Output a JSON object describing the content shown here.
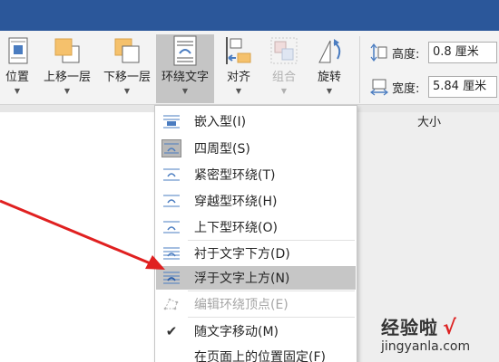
{
  "ribbon": {
    "buttons": [
      {
        "name": "position",
        "label": "位置",
        "icon": "position-icon",
        "state": "normal"
      },
      {
        "name": "bring-forward",
        "label": "上移一层",
        "icon": "bring-forward-icon",
        "state": "normal"
      },
      {
        "name": "send-backward",
        "label": "下移一层",
        "icon": "send-backward-icon",
        "state": "normal"
      },
      {
        "name": "wrap-text",
        "label": "环绕文字",
        "icon": "wrap-text-icon",
        "state": "selected"
      },
      {
        "name": "align",
        "label": "对齐",
        "icon": "align-icon",
        "state": "normal"
      },
      {
        "name": "group",
        "label": "组合",
        "icon": "group-icon",
        "state": "disabled"
      },
      {
        "name": "rotate",
        "label": "旋转",
        "icon": "rotate-icon",
        "state": "normal"
      }
    ],
    "size": {
      "height_label": "高度:",
      "height_value": "0.8 厘米",
      "width_label": "宽度:",
      "width_value": "5.84 厘米",
      "group_label": "大小"
    }
  },
  "menu": {
    "items": [
      {
        "label": "嵌入型(I)",
        "icon": "inline-icon",
        "state": "normal"
      },
      {
        "label": "四周型(S)",
        "icon": "square-wrap-icon",
        "state": "boxed"
      },
      {
        "label": "紧密型环绕(T)",
        "icon": "tight-wrap-icon",
        "state": "normal"
      },
      {
        "label": "穿越型环绕(H)",
        "icon": "through-wrap-icon",
        "state": "normal"
      },
      {
        "label": "上下型环绕(O)",
        "icon": "top-bottom-wrap-icon",
        "state": "normal"
      },
      {
        "label": "衬于文字下方(D)",
        "icon": "behind-text-icon",
        "state": "normal"
      },
      {
        "label": "浮于文字上方(N)",
        "icon": "in-front-of-text-icon",
        "state": "hover"
      },
      {
        "label": "编辑环绕顶点(E)",
        "icon": "edit-wrap-points-icon",
        "state": "disabled"
      },
      {
        "label": "随文字移动(M)",
        "icon": "checkmark-icon",
        "state": "checked"
      },
      {
        "label": "在页面上的位置固定(F)",
        "icon": "fix-position-icon",
        "state": "normal"
      }
    ]
  },
  "watermark": {
    "brand": "经验啦",
    "check": "√",
    "url": "jingyanla.com"
  },
  "colors": {
    "title_bar": "#2b579a",
    "ribbon_bg": "#f3f3f3",
    "menu_hover": "#c6c6c6",
    "arrow_red": "#e02020",
    "icon_blue": "#4a7cc0",
    "icon_orange": "#f5c16c"
  }
}
